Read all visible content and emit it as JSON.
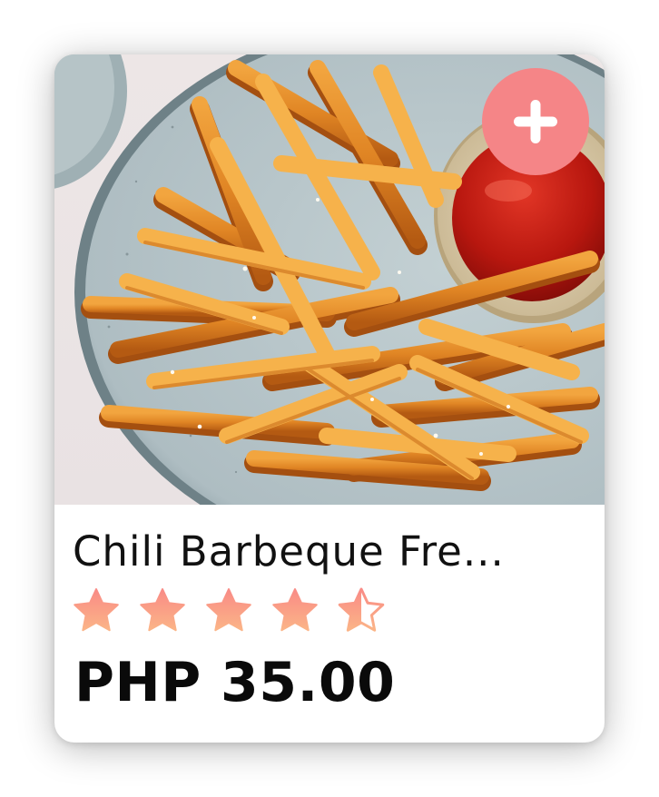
{
  "product": {
    "name": "Chili Barbeque Fre...",
    "price": "PHP 35.00",
    "image_icon": "fries-with-ketchup-image",
    "rating": 4.5,
    "max_rating": 5
  },
  "add_button": {
    "icon": "plus-icon",
    "color": "#F58587"
  },
  "colors": {
    "star_top": "#F98B86",
    "star_bottom": "#FBB487",
    "text": "#111111"
  }
}
